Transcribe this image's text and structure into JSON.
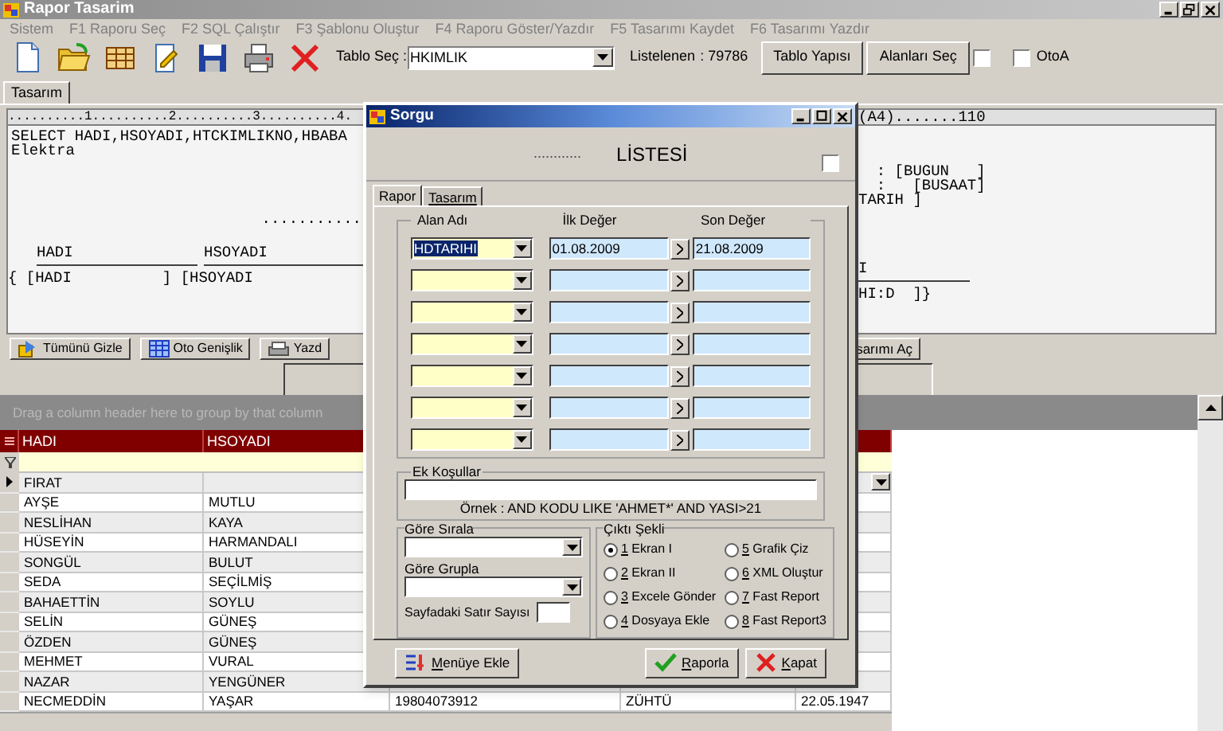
{
  "window": {
    "title": "Rapor Tasarim"
  },
  "menu": [
    "Sistem",
    "F1 Raporu Seç",
    "F2 SQL Çalıştır",
    "F3 Şablonu Oluştur",
    "F4 Raporu Göster/Yazdır",
    "F5 Tasarımı Kaydet",
    "F6 Tasarımı Yazdır"
  ],
  "toolbar": {
    "table_label": "Tablo Seç :",
    "table_value": "HKIMLIK",
    "count_label": "Listelenen",
    "count_value": ": 79786",
    "buttons": [
      "Tablo Yapısı",
      "Alanları Seç"
    ],
    "plain_checked": false,
    "otoa": {
      "label": "OtoA",
      "checked": false
    }
  },
  "tabs": [
    {
      "label": "Tasarım",
      "selected": true
    }
  ],
  "design": {
    "ruler_left": "..........1..........2..........3..........4.",
    "ruler_right": "(A4).......110",
    "query": [
      "SELECT HADI,HSOYADI,HTCKIMLIKNO,HBABA",
      "Elektra"
    ],
    "dots": "...........",
    "heading_left": [
      "HADI",
      "HSOYADI"
    ],
    "band_left": "{ [HADI          ] [HSOYADI",
    "right_top": [
      "  : [BUGUN   ]",
      "  :   [BUSAAT]",
      "TARIH ]"
    ],
    "heading_right": "I",
    "band_right": "HI:D  ]}"
  },
  "design_buttons": [
    "Tümünü Gizle",
    "Oto Genişlik",
    "Yazd"
  ],
  "design_button_right": "sarımı Aç",
  "grid": {
    "group_hint": "Drag a column header here to group by that column",
    "columns": [
      "HADI",
      "HSOYADI"
    ],
    "rows": [
      {
        "cells": [
          "FIRAT"
        ],
        "selected": true
      },
      {
        "cells": [
          "AYŞE",
          "MUTLU"
        ],
        "selected": false
      },
      {
        "cells": [
          "NESLİHAN",
          "KAYA"
        ],
        "selected": false
      },
      {
        "cells": [
          "HÜSEYİN",
          "HARMANDALI"
        ],
        "selected": false
      },
      {
        "cells": [
          "SONGÜL",
          "BULUT"
        ],
        "selected": false
      },
      {
        "cells": [
          "SEDA",
          "SEÇİLMİŞ"
        ],
        "selected": false
      },
      {
        "cells": [
          "BAHAETTİN",
          "SOYLU"
        ],
        "selected": false
      },
      {
        "cells": [
          "SELİN",
          "GÜNEŞ"
        ],
        "selected": false
      },
      {
        "cells": [
          "ÖZDEN",
          "GÜNEŞ"
        ],
        "selected": false
      },
      {
        "cells": [
          "MEHMET",
          "VURAL"
        ],
        "selected": false
      },
      {
        "cells": [
          "NAZAR",
          "YENGÜNER"
        ],
        "selected": false
      },
      {
        "cells": [
          "NECMEDDİN",
          "YAŞAR",
          "19804073912",
          "ZÜHTÜ",
          "22.05.1947"
        ],
        "selected": false
      }
    ]
  },
  "dialog": {
    "title": "Sorgu",
    "header_dots": "............",
    "header_title": "LİSTESİ",
    "header_checked": false,
    "tabs": [
      {
        "label": "Rapor",
        "selected": true
      },
      {
        "label": "Tasarım",
        "selected": false
      }
    ],
    "criteria_columns": [
      "Alan Adı",
      "İlk Değer",
      "Son Değer"
    ],
    "criteria": [
      {
        "kind": "filled",
        "field": "HDTARIHI",
        "first": "01.08.2009",
        "last": "21.08.2009"
      },
      {
        "kind": "blank"
      },
      {
        "kind": "blank"
      },
      {
        "kind": "blank"
      },
      {
        "kind": "blank"
      },
      {
        "kind": "blank"
      },
      {
        "kind": "blank"
      }
    ],
    "extra_label": "Ek Koşullar",
    "extra_example": "Örnek : AND KODU LIKE 'AHMET*' AND YASI>21",
    "sort_label": "Göre Sırala",
    "group_label": "Göre Grupla",
    "rows_per_page_label": "Sayfadaki Satır Sayısı",
    "output_label": "Çıktı Şekli",
    "outputs": [
      {
        "label": "1 Ekran I",
        "selected": true
      },
      {
        "label": "5 Grafik Çiz",
        "selected": false
      },
      {
        "label": "2 Ekran II",
        "selected": false
      },
      {
        "label": "6 XML Oluştur",
        "selected": false
      },
      {
        "label": "3 Excele Gönder",
        "selected": false
      },
      {
        "label": "7 Fast Report",
        "selected": false
      },
      {
        "label": "4 Dosyaya Ekle",
        "selected": false
      },
      {
        "label": "8 Fast Report3",
        "selected": false
      }
    ],
    "buttons": [
      {
        "kind": "menu",
        "label": "Menüye Ekle"
      },
      {
        "kind": "ok",
        "label": "Raporla"
      },
      {
        "kind": "close",
        "label": "Kapat"
      }
    ]
  }
}
